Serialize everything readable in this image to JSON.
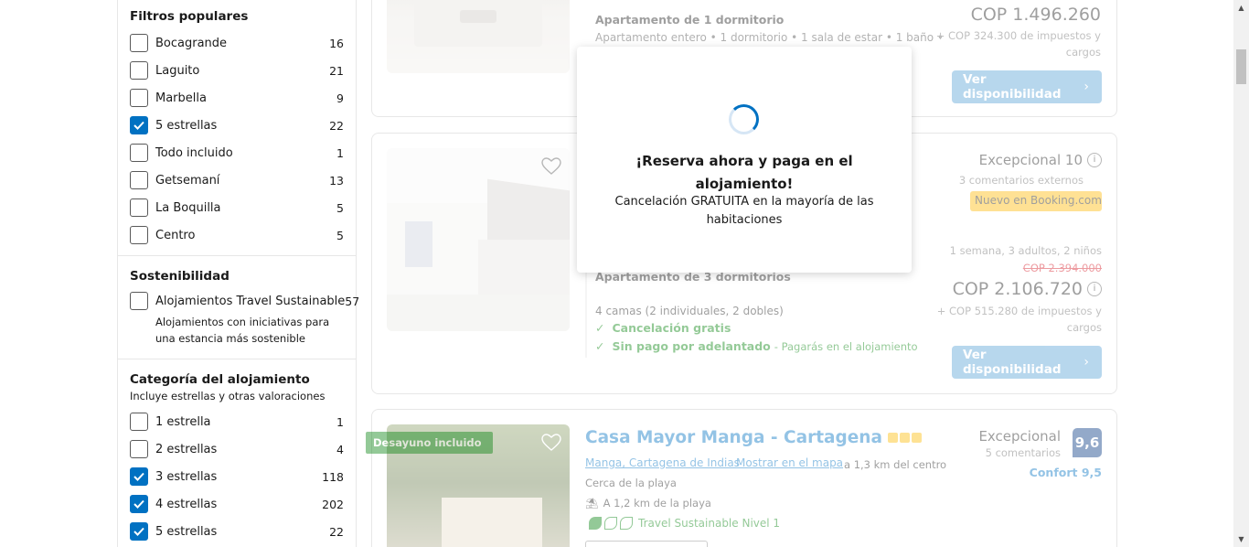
{
  "filters_popular": {
    "title": "Filtros populares",
    "items": [
      {
        "label": "Bocagrande",
        "count": "16",
        "checked": false
      },
      {
        "label": "Laguito",
        "count": "21",
        "checked": false
      },
      {
        "label": "Marbella",
        "count": "9",
        "checked": false
      },
      {
        "label": "5 estrellas",
        "count": "22",
        "checked": true
      },
      {
        "label": "Todo incluido",
        "count": "1",
        "checked": false
      },
      {
        "label": "Getsemaní",
        "count": "13",
        "checked": false
      },
      {
        "label": "La Boquilla",
        "count": "5",
        "checked": false
      },
      {
        "label": "Centro",
        "count": "5",
        "checked": false
      }
    ]
  },
  "sustainability": {
    "title": "Sostenibilidad",
    "item_label": "Alojamientos Travel Sustainable",
    "item_count": "57",
    "item_desc": "Alojamientos con iniciativas para una estancia más sostenible"
  },
  "category": {
    "title": "Categoría del alojamiento",
    "subtitle": "Incluye estrellas y otras valoraciones",
    "items": [
      {
        "label": "1 estrella",
        "count": "1",
        "checked": false
      },
      {
        "label": "2 estrellas",
        "count": "4",
        "checked": false
      },
      {
        "label": "3 estrellas",
        "count": "118",
        "checked": true
      },
      {
        "label": "4 estrellas",
        "count": "202",
        "checked": true
      },
      {
        "label": "5 estrellas",
        "count": "22",
        "checked": true
      }
    ]
  },
  "card1": {
    "room_type": "Apartamento de 1 dormitorio",
    "room_details": "Apartamento entero • 1 dormitorio • 1 sala de estar • 1 baño •",
    "price": "COP 1.496.260",
    "taxes_line1": "+ COP 324.300 de impuestos y",
    "taxes_line2": "cargos",
    "button": "Ver disponibilidad"
  },
  "card2": {
    "rating_label": "Excepcional 10",
    "reviews": "3 comentarios externos",
    "new_badge": "Nuevo en Booking.com",
    "stay": "1 semana, 3 adultos, 2 niños",
    "old_price": "COP 2.394.000",
    "price": "COP 2.106.720",
    "taxes_line1": "+ COP 515.280 de impuestos y",
    "taxes_line2": "cargos",
    "room_type": "Apartamento de 3 dormitorios",
    "beds": "4 camas (2 individuales, 2 dobles)",
    "free_cancel": "Cancelación gratis",
    "no_prepay": "Sin pago por adelantado",
    "pay_at_property": "- Pagarás en el alojamiento",
    "button": "Ver disponibilidad"
  },
  "card3": {
    "badge": "Desayuno incluido",
    "name": "Casa Mayor Manga - Cartagena",
    "location": "Manga, Cartagena de Indias",
    "map_link": "Mostrar en el mapa",
    "distance": "a 1,3 km del centro",
    "near_beach": "Cerca de la playa",
    "beach_distance": "A 1,2 km de la playa",
    "sustainable": "Travel Sustainable Nivel 1",
    "rating_label": "Excepcional",
    "reviews": "5 comentarios",
    "score": "9,6",
    "comfort": "Confort 9,5"
  },
  "overlay": {
    "title": "¡Reserva ahora y paga en el alojamiento!",
    "subtitle": "Cancelación GRATUITA en la mayoría de las habitaciones"
  },
  "colors": {
    "brand_blue": "#0071c2",
    "green": "#008009",
    "star_yellow": "#febb02"
  }
}
